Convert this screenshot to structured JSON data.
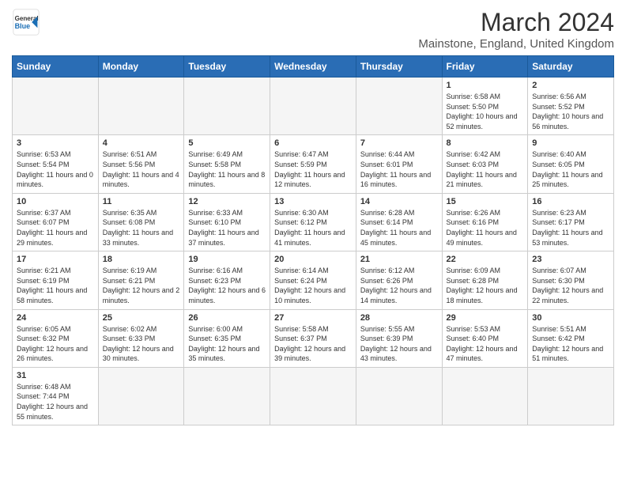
{
  "header": {
    "logo_general": "General",
    "logo_blue": "Blue",
    "title": "March 2024",
    "subtitle": "Mainstone, England, United Kingdom"
  },
  "weekdays": [
    "Sunday",
    "Monday",
    "Tuesday",
    "Wednesday",
    "Thursday",
    "Friday",
    "Saturday"
  ],
  "weeks": [
    [
      {
        "day": "",
        "info": ""
      },
      {
        "day": "",
        "info": ""
      },
      {
        "day": "",
        "info": ""
      },
      {
        "day": "",
        "info": ""
      },
      {
        "day": "",
        "info": ""
      },
      {
        "day": "1",
        "info": "Sunrise: 6:58 AM\nSunset: 5:50 PM\nDaylight: 10 hours and 52 minutes."
      },
      {
        "day": "2",
        "info": "Sunrise: 6:56 AM\nSunset: 5:52 PM\nDaylight: 10 hours and 56 minutes."
      }
    ],
    [
      {
        "day": "3",
        "info": "Sunrise: 6:53 AM\nSunset: 5:54 PM\nDaylight: 11 hours and 0 minutes."
      },
      {
        "day": "4",
        "info": "Sunrise: 6:51 AM\nSunset: 5:56 PM\nDaylight: 11 hours and 4 minutes."
      },
      {
        "day": "5",
        "info": "Sunrise: 6:49 AM\nSunset: 5:58 PM\nDaylight: 11 hours and 8 minutes."
      },
      {
        "day": "6",
        "info": "Sunrise: 6:47 AM\nSunset: 5:59 PM\nDaylight: 11 hours and 12 minutes."
      },
      {
        "day": "7",
        "info": "Sunrise: 6:44 AM\nSunset: 6:01 PM\nDaylight: 11 hours and 16 minutes."
      },
      {
        "day": "8",
        "info": "Sunrise: 6:42 AM\nSunset: 6:03 PM\nDaylight: 11 hours and 21 minutes."
      },
      {
        "day": "9",
        "info": "Sunrise: 6:40 AM\nSunset: 6:05 PM\nDaylight: 11 hours and 25 minutes."
      }
    ],
    [
      {
        "day": "10",
        "info": "Sunrise: 6:37 AM\nSunset: 6:07 PM\nDaylight: 11 hours and 29 minutes."
      },
      {
        "day": "11",
        "info": "Sunrise: 6:35 AM\nSunset: 6:08 PM\nDaylight: 11 hours and 33 minutes."
      },
      {
        "day": "12",
        "info": "Sunrise: 6:33 AM\nSunset: 6:10 PM\nDaylight: 11 hours and 37 minutes."
      },
      {
        "day": "13",
        "info": "Sunrise: 6:30 AM\nSunset: 6:12 PM\nDaylight: 11 hours and 41 minutes."
      },
      {
        "day": "14",
        "info": "Sunrise: 6:28 AM\nSunset: 6:14 PM\nDaylight: 11 hours and 45 minutes."
      },
      {
        "day": "15",
        "info": "Sunrise: 6:26 AM\nSunset: 6:16 PM\nDaylight: 11 hours and 49 minutes."
      },
      {
        "day": "16",
        "info": "Sunrise: 6:23 AM\nSunset: 6:17 PM\nDaylight: 11 hours and 53 minutes."
      }
    ],
    [
      {
        "day": "17",
        "info": "Sunrise: 6:21 AM\nSunset: 6:19 PM\nDaylight: 11 hours and 58 minutes."
      },
      {
        "day": "18",
        "info": "Sunrise: 6:19 AM\nSunset: 6:21 PM\nDaylight: 12 hours and 2 minutes."
      },
      {
        "day": "19",
        "info": "Sunrise: 6:16 AM\nSunset: 6:23 PM\nDaylight: 12 hours and 6 minutes."
      },
      {
        "day": "20",
        "info": "Sunrise: 6:14 AM\nSunset: 6:24 PM\nDaylight: 12 hours and 10 minutes."
      },
      {
        "day": "21",
        "info": "Sunrise: 6:12 AM\nSunset: 6:26 PM\nDaylight: 12 hours and 14 minutes."
      },
      {
        "day": "22",
        "info": "Sunrise: 6:09 AM\nSunset: 6:28 PM\nDaylight: 12 hours and 18 minutes."
      },
      {
        "day": "23",
        "info": "Sunrise: 6:07 AM\nSunset: 6:30 PM\nDaylight: 12 hours and 22 minutes."
      }
    ],
    [
      {
        "day": "24",
        "info": "Sunrise: 6:05 AM\nSunset: 6:32 PM\nDaylight: 12 hours and 26 minutes."
      },
      {
        "day": "25",
        "info": "Sunrise: 6:02 AM\nSunset: 6:33 PM\nDaylight: 12 hours and 30 minutes."
      },
      {
        "day": "26",
        "info": "Sunrise: 6:00 AM\nSunset: 6:35 PM\nDaylight: 12 hours and 35 minutes."
      },
      {
        "day": "27",
        "info": "Sunrise: 5:58 AM\nSunset: 6:37 PM\nDaylight: 12 hours and 39 minutes."
      },
      {
        "day": "28",
        "info": "Sunrise: 5:55 AM\nSunset: 6:39 PM\nDaylight: 12 hours and 43 minutes."
      },
      {
        "day": "29",
        "info": "Sunrise: 5:53 AM\nSunset: 6:40 PM\nDaylight: 12 hours and 47 minutes."
      },
      {
        "day": "30",
        "info": "Sunrise: 5:51 AM\nSunset: 6:42 PM\nDaylight: 12 hours and 51 minutes."
      }
    ],
    [
      {
        "day": "31",
        "info": "Sunrise: 6:48 AM\nSunset: 7:44 PM\nDaylight: 12 hours and 55 minutes."
      },
      {
        "day": "",
        "info": ""
      },
      {
        "day": "",
        "info": ""
      },
      {
        "day": "",
        "info": ""
      },
      {
        "day": "",
        "info": ""
      },
      {
        "day": "",
        "info": ""
      },
      {
        "day": "",
        "info": ""
      }
    ]
  ]
}
